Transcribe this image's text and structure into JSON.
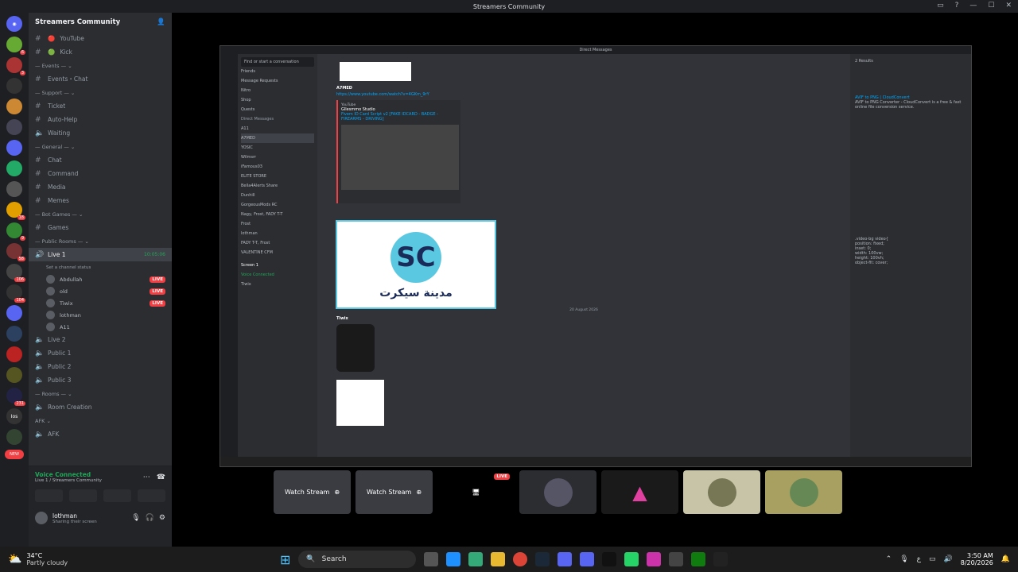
{
  "window": {
    "title": "Streamers Community"
  },
  "server": {
    "name": "Streamers Community",
    "top_channels": [
      {
        "name": "YouTube",
        "emoji": "🔴"
      },
      {
        "name": "Kick",
        "emoji": "🟢"
      }
    ],
    "categories": [
      {
        "label": "— Events — ⌄",
        "channels": [
          {
            "name": "Events・Chat"
          }
        ]
      },
      {
        "label": "— Support — ⌄",
        "channels": [
          {
            "name": "Ticket"
          },
          {
            "name": "Auto-Help"
          },
          {
            "name": "Waiting"
          }
        ]
      },
      {
        "label": "— General — ⌄",
        "channels": [
          {
            "name": "Chat"
          },
          {
            "name": "Command"
          },
          {
            "name": "Media"
          },
          {
            "name": "Memes"
          }
        ]
      },
      {
        "label": "— Bot Games — ⌄",
        "channels": [
          {
            "name": "Games"
          }
        ]
      },
      {
        "label": "— Public Rooms — ⌄",
        "channels": []
      }
    ],
    "voice_live1": {
      "name": "Live 1",
      "status": "Set a channel status",
      "timer": "10:05:06",
      "users": [
        {
          "name": "Abdullah",
          "live": true
        },
        {
          "name": "old",
          "live": true
        },
        {
          "name": "Tiwix",
          "live": true
        },
        {
          "name": "lothman",
          "live": false
        },
        {
          "name": "A11",
          "live": false
        }
      ]
    },
    "voice_channels": [
      "Live 2",
      "Public 1",
      "Public 2",
      "Public 3"
    ],
    "rooms_label": "— Rooms — ⌄",
    "room_creation": "Room Creation",
    "afk_label": "AFK ⌄",
    "afk_channel": "AFK"
  },
  "live_badge": "LIVE",
  "voice_panel": {
    "title": "Voice Connected",
    "subtitle": "Live 1 / Streamers Community",
    "user_name": "lothman",
    "user_status": "Sharing their screen"
  },
  "rail_badges": [
    "6",
    "3",
    "18",
    "9",
    "58",
    "106",
    "104",
    "231",
    "NEW"
  ],
  "stream": {
    "inner_title": "Direct Messages",
    "inner_search_placeholder": "Find or start a conversation",
    "inner_nav": [
      "Friends",
      "Message Requests",
      "Nitro",
      "Shop",
      "Quests"
    ],
    "inner_dm_header": "Direct Messages",
    "inner_dms": [
      "A11",
      "A7MED",
      "YOSIC",
      "Wilmsrr",
      "iFamous03",
      "ELITE STORE",
      "Bella4Alerts Share",
      "Dunhill",
      "GorgeousMods RC",
      "Nagy, Frost, FADY T-T",
      "Frost",
      "lothman",
      "FADY T-T, Frost",
      "VALENTINE CFM"
    ],
    "chat_author": "A7MED",
    "chat_link": "https://www.youtube.com/watch?v=4GKm_9rY",
    "embed_provider": "YouTube",
    "embed_channel": "Gllesmmo Studio",
    "embed_title": "Fivem ID Card Script v2 [FAKE IDCARD - BADGE - FIREARMS - DRIVING]",
    "logo_text": "مدينة سيكرت",
    "date_divider": "20 August 2026",
    "second_author": "Tiwix",
    "results_label": "2 Results",
    "result_title": "AVIF to PNG | CloudConvert",
    "result_desc": "AVIF to PNG Converter - CloudConvert is a free & fast online file conversion service.",
    "code_lines": [
      ".video-bg video{",
      "position: fixed;",
      "inset: 0;",
      "width: 100vw;",
      "height: 100vh;",
      "object-fit: cover;"
    ],
    "inner_user": "Tiwix",
    "screen_label": "Screen 1",
    "voice_connected": "Voice Connected"
  },
  "tiles": [
    {
      "label": "Watch Stream"
    },
    {
      "label": "Watch Stream"
    },
    {
      "label": ""
    },
    {
      "label": ""
    },
    {
      "label": ""
    },
    {
      "label": ""
    },
    {
      "label": ""
    }
  ],
  "taskbar": {
    "weather_temp": "34°C",
    "weather_desc": "Partly cloudy",
    "search": "Search",
    "time": "3:50 AM",
    "date": "8/20/2026"
  }
}
